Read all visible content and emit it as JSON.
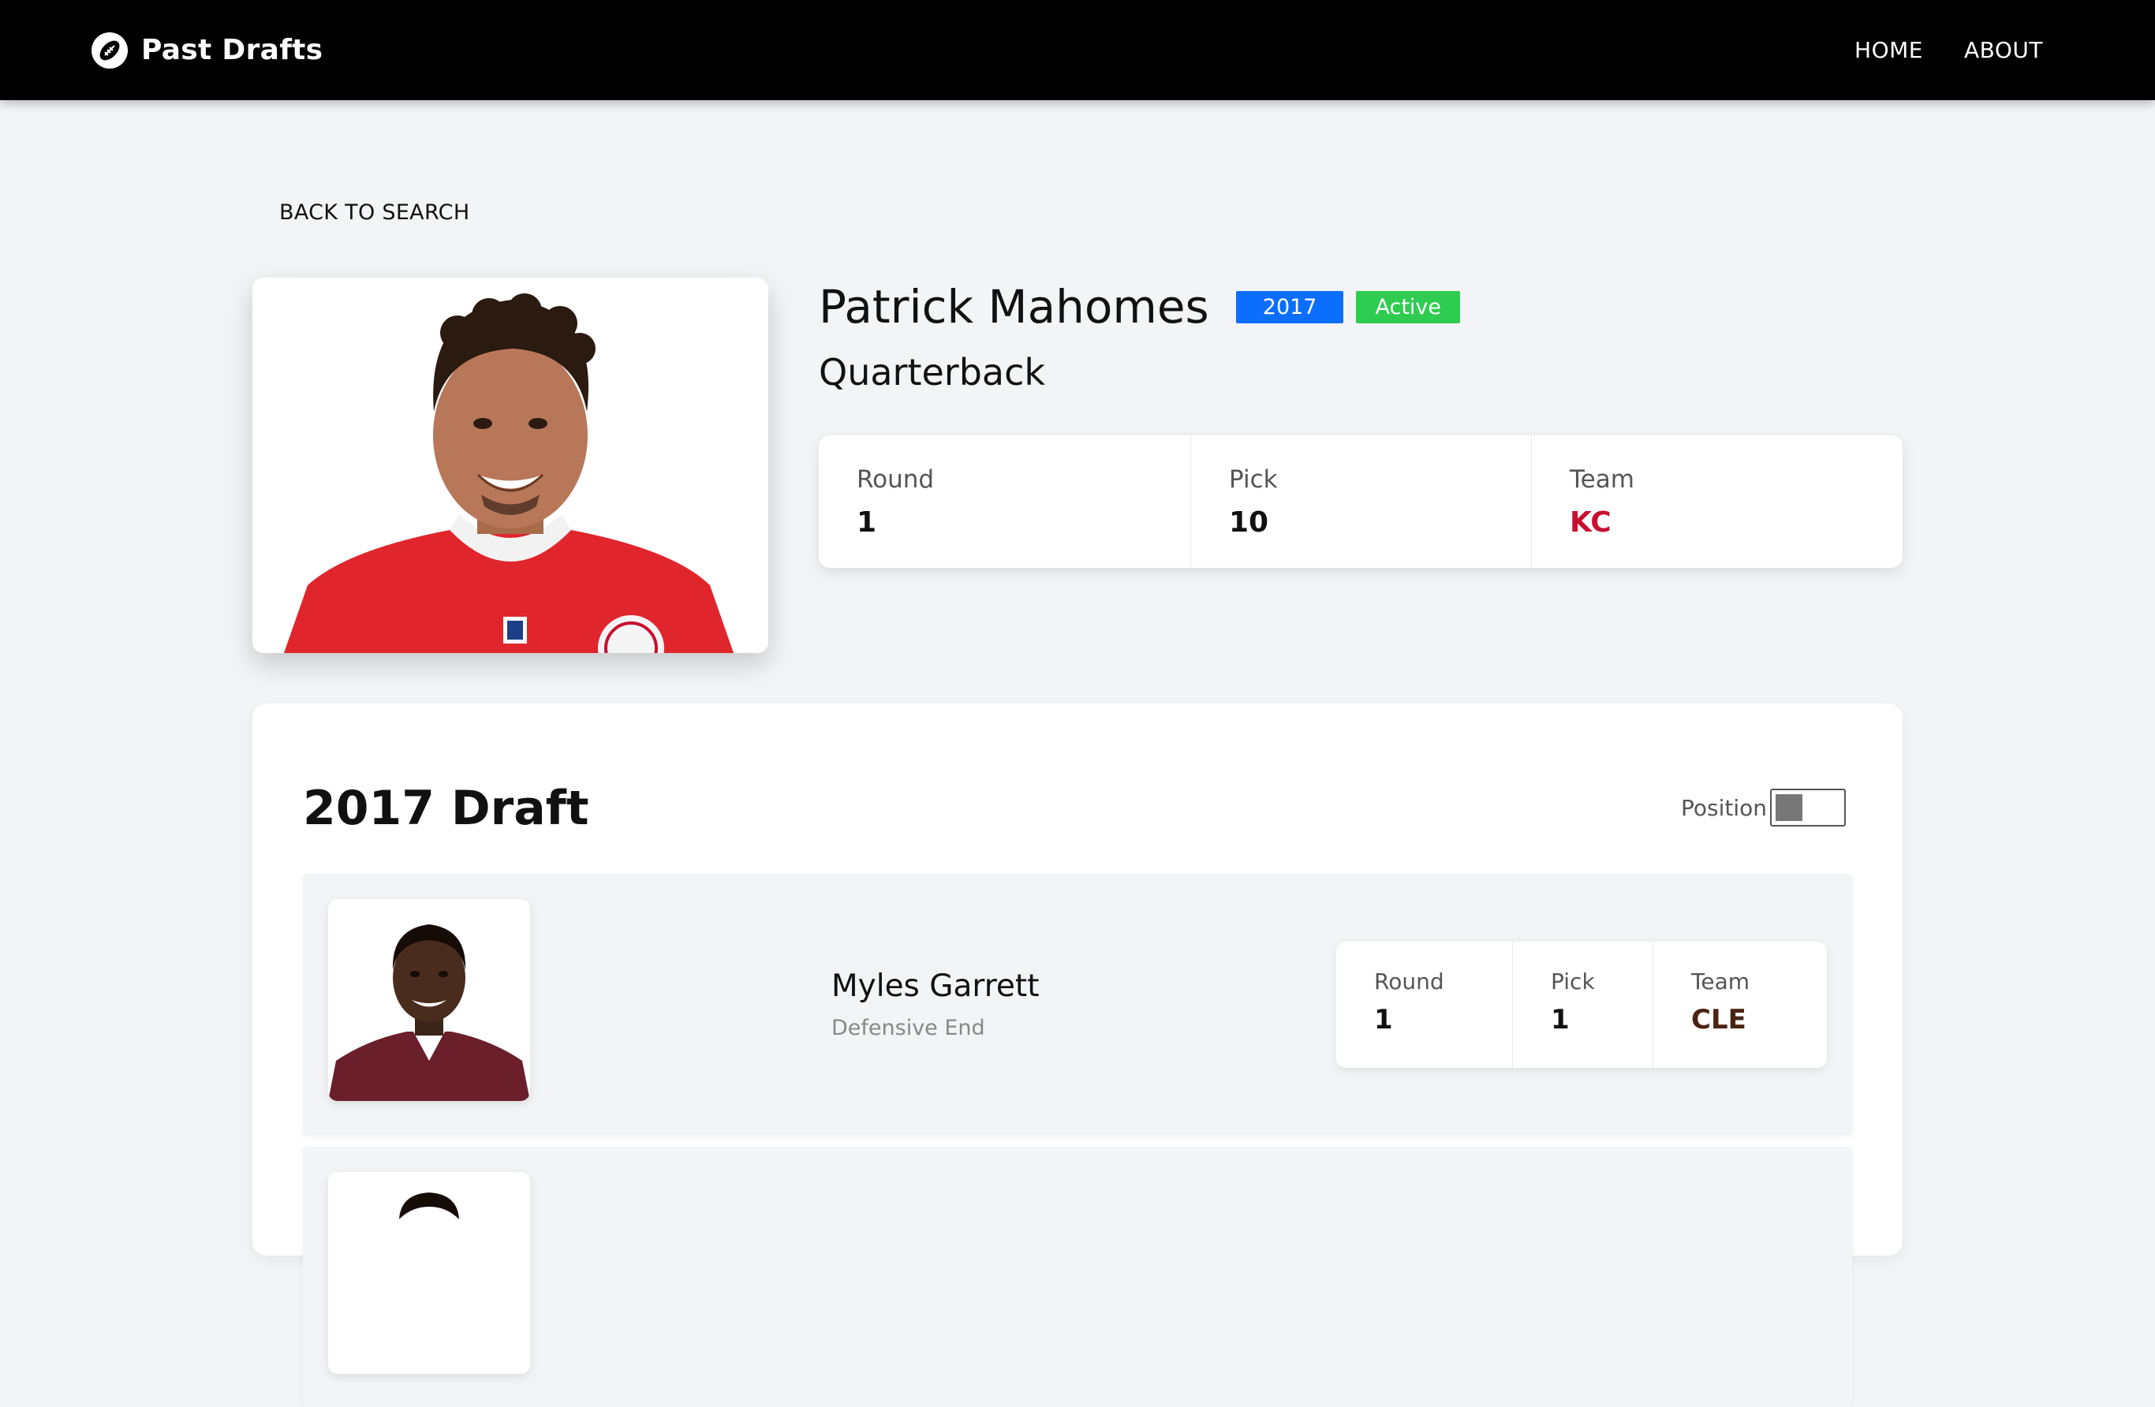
{
  "nav": {
    "brand": "Past Drafts",
    "links": [
      "HOME",
      "ABOUT"
    ]
  },
  "back_link": "BACK TO SEARCH",
  "player": {
    "name": "Patrick Mahomes",
    "year_badge": "2017",
    "status_badge": "Active",
    "position": "Quarterback",
    "stats": {
      "round_label": "Round",
      "round": "1",
      "pick_label": "Pick",
      "pick": "10",
      "team_label": "Team",
      "team": "KC"
    }
  },
  "draft": {
    "title": "2017 Draft",
    "toggle_label": "Position",
    "picks": [
      {
        "name": "Myles Garrett",
        "position": "Defensive End",
        "round_label": "Round",
        "round": "1",
        "pick_label": "Pick",
        "pick": "1",
        "team_label": "Team",
        "team": "CLE"
      }
    ]
  },
  "colors": {
    "navbar": "#000000",
    "year_badge": "#0b6efd",
    "status_badge": "#2ecc50",
    "kc_team": "#c8102e",
    "cle_team": "#4a2412"
  }
}
